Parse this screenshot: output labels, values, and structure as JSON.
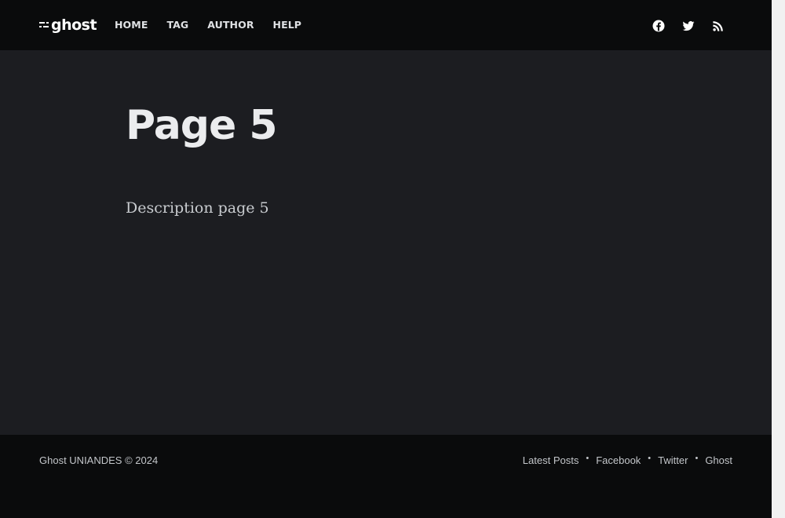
{
  "header": {
    "logo_text": "ghost",
    "nav": [
      {
        "label": "HOME"
      },
      {
        "label": "TAG"
      },
      {
        "label": "AUTHOR"
      },
      {
        "label": "HELP"
      }
    ],
    "social_icons": [
      "facebook-icon",
      "twitter-icon",
      "rss-icon"
    ]
  },
  "main": {
    "title": "Page 5",
    "description": "Description page 5"
  },
  "footer": {
    "copyright": "Ghost UNIANDES © 2024",
    "links": [
      {
        "label": "Latest Posts"
      },
      {
        "label": "Facebook"
      },
      {
        "label": "Twitter"
      },
      {
        "label": "Ghost"
      }
    ]
  },
  "colors": {
    "nav_background": "#0a0b0c",
    "content_background": "#1c1d21",
    "title_text": "#ebecee",
    "nav_text": "#dfe1e4"
  }
}
